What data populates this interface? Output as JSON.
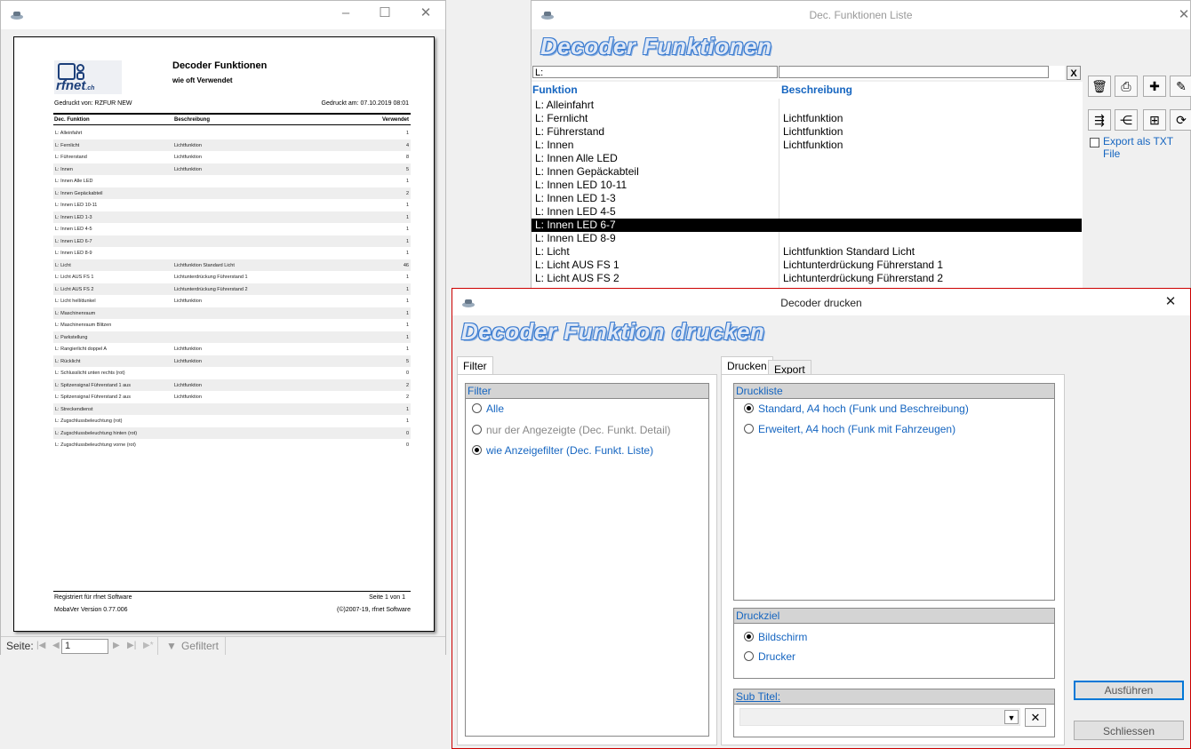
{
  "preview_window": {
    "title": "",
    "report": {
      "logo_text": "rfnet",
      "logo_suffix": ".ch",
      "title": "Decoder Funktionen",
      "subtitle": "wie oft Verwendet",
      "printed_by": "Gedruckt von:  RZFUR NEW",
      "printed_at": "Gedruckt am:  07.10.2019 08:01",
      "col_function": "Dec. Funktion",
      "col_description": "Beschreibung",
      "col_used": "Verwendet",
      "rows": [
        {
          "f": "L: Alleinfahrt",
          "b": "",
          "v": "1"
        },
        {
          "f": "L: Fernlicht",
          "b": "Lichtfunktion",
          "v": "4"
        },
        {
          "f": "L: Führerstand",
          "b": "Lichtfunktion",
          "v": "8"
        },
        {
          "f": "L: Innen",
          "b": "Lichtfunktion",
          "v": "5"
        },
        {
          "f": "L: Innen Alle LED",
          "b": "",
          "v": "1"
        },
        {
          "f": "L: Innen Gepäckabteil",
          "b": "",
          "v": "2"
        },
        {
          "f": "L: Innen LED 10-11",
          "b": "",
          "v": "1"
        },
        {
          "f": "L: Innen LED 1-3",
          "b": "",
          "v": "1"
        },
        {
          "f": "L: Innen LED 4-5",
          "b": "",
          "v": "1"
        },
        {
          "f": "L: Innen LED 6-7",
          "b": "",
          "v": "1"
        },
        {
          "f": "L: Innen LED 8-9",
          "b": "",
          "v": "1"
        },
        {
          "f": "L: Licht",
          "b": "Lichtfunktion Standard Licht",
          "v": "46"
        },
        {
          "f": "L: Licht AUS FS 1",
          "b": "Lichtunterdrückung Führerstand 1",
          "v": "1"
        },
        {
          "f": "L: Licht AUS FS 2",
          "b": "Lichtunterdrückung Führerstand 2",
          "v": "1"
        },
        {
          "f": "L: Licht hell/dunkel",
          "b": "Lichtfunktion",
          "v": "1"
        },
        {
          "f": "L: Maschinenraum",
          "b": "",
          "v": "1"
        },
        {
          "f": "L: Maschinenraum Blitzen",
          "b": "",
          "v": "1"
        },
        {
          "f": "L: Parkstellung",
          "b": "",
          "v": "1"
        },
        {
          "f": "L: Rangierlicht doppel A",
          "b": "Lichtfunktion",
          "v": "1"
        },
        {
          "f": "L: Rücklicht",
          "b": "Lichtfunktion",
          "v": "5"
        },
        {
          "f": "L: Schlusslicht unten rechts (rot)",
          "b": "",
          "v": "0"
        },
        {
          "f": "L: Spitzensignal Führerstand 1 aus",
          "b": "Lichtfunktion",
          "v": "2"
        },
        {
          "f": "L: Spitzensignal Führerstand 2 aus",
          "b": "Lichtfunktion",
          "v": "2"
        },
        {
          "f": "L: Streckendienst",
          "b": "",
          "v": "1"
        },
        {
          "f": "L: Zugschlussbeleuchtung (rot)",
          "b": "",
          "v": "1"
        },
        {
          "f": "L: Zugschlussbeleuchtung hinten (rot)",
          "b": "",
          "v": "0"
        },
        {
          "f": "L: Zugschlussbeleuchtung vorne (rot)",
          "b": "",
          "v": "0"
        }
      ],
      "footer_registered": "Registriert für rfnet Software",
      "footer_page": "Seite 1 von 1",
      "footer_version": "MobaVer Version 0.77.006",
      "footer_copyright": "(©)2007-19, rfnet Software"
    },
    "statusbar": {
      "page_label": "Seite:",
      "page_value": "1",
      "filter_label": "Gefiltert"
    }
  },
  "list_window": {
    "title": "Dec. Funktionen Liste",
    "banner": "Decoder Funktionen",
    "filter_value": "L:",
    "filter_clear": "X",
    "col_function": "Funktion",
    "col_description": "Beschreibung",
    "selected_index": 9,
    "rows": [
      {
        "f": "L: Alleinfahrt",
        "b": ""
      },
      {
        "f": "L: Fernlicht",
        "b": "Lichtfunktion"
      },
      {
        "f": "L: Führerstand",
        "b": "Lichtfunktion"
      },
      {
        "f": "L: Innen",
        "b": "Lichtfunktion"
      },
      {
        "f": "L: Innen Alle LED",
        "b": ""
      },
      {
        "f": "L: Innen Gepäckabteil",
        "b": ""
      },
      {
        "f": "L: Innen LED 10-11",
        "b": ""
      },
      {
        "f": "L: Innen LED 1-3",
        "b": ""
      },
      {
        "f": "L: Innen LED 4-5",
        "b": ""
      },
      {
        "f": "L: Innen LED 6-7",
        "b": ""
      },
      {
        "f": "L: Innen LED 8-9",
        "b": ""
      },
      {
        "f": "L: Licht",
        "b": "Lichtfunktion Standard Licht"
      },
      {
        "f": "L: Licht AUS FS 1",
        "b": "Lichtunterdrückung Führerstand 1"
      },
      {
        "f": "L: Licht AUS FS 2",
        "b": "Lichtunterdrückung Führerstand 2"
      }
    ],
    "export_txt_label": "Export als TXT File",
    "toolbar_icons": [
      "trash-icon",
      "print-icon",
      "new-icon",
      "edit-icon",
      "import-icon",
      "split-icon",
      "tree-icon",
      "refresh-icon"
    ]
  },
  "print_dialog": {
    "title": "Decoder drucken",
    "banner": "Decoder Funktion drucken",
    "tab_filter": "Filter",
    "tab_drucken": "Drucken",
    "tab_export": "Export",
    "filter_group": "Filter",
    "filter_options": [
      "Alle",
      "nur der Angezeigte (Dec. Funkt. Detail)",
      "wie Anzeigefilter (Dec. Funkt. Liste)"
    ],
    "filter_selected": 2,
    "druckliste_group": "Druckliste",
    "druckliste_options": [
      "Standard, A4 hoch (Funk und Beschreibung)",
      "Erweitert, A4 hoch (Funk mit Fahrzeugen)"
    ],
    "druckliste_selected": 0,
    "druckziel_group": "Druckziel",
    "druckziel_options": [
      "Bildschirm",
      "Drucker"
    ],
    "druckziel_selected": 0,
    "subtitel_group": "Sub Titel:",
    "subtitel_value": "",
    "btn_run": "Ausführen",
    "btn_close": "Schliessen"
  },
  "colors": {
    "accent_blue": "#1565c0",
    "selection": "#000000",
    "dialog_border": "#cc0000"
  }
}
